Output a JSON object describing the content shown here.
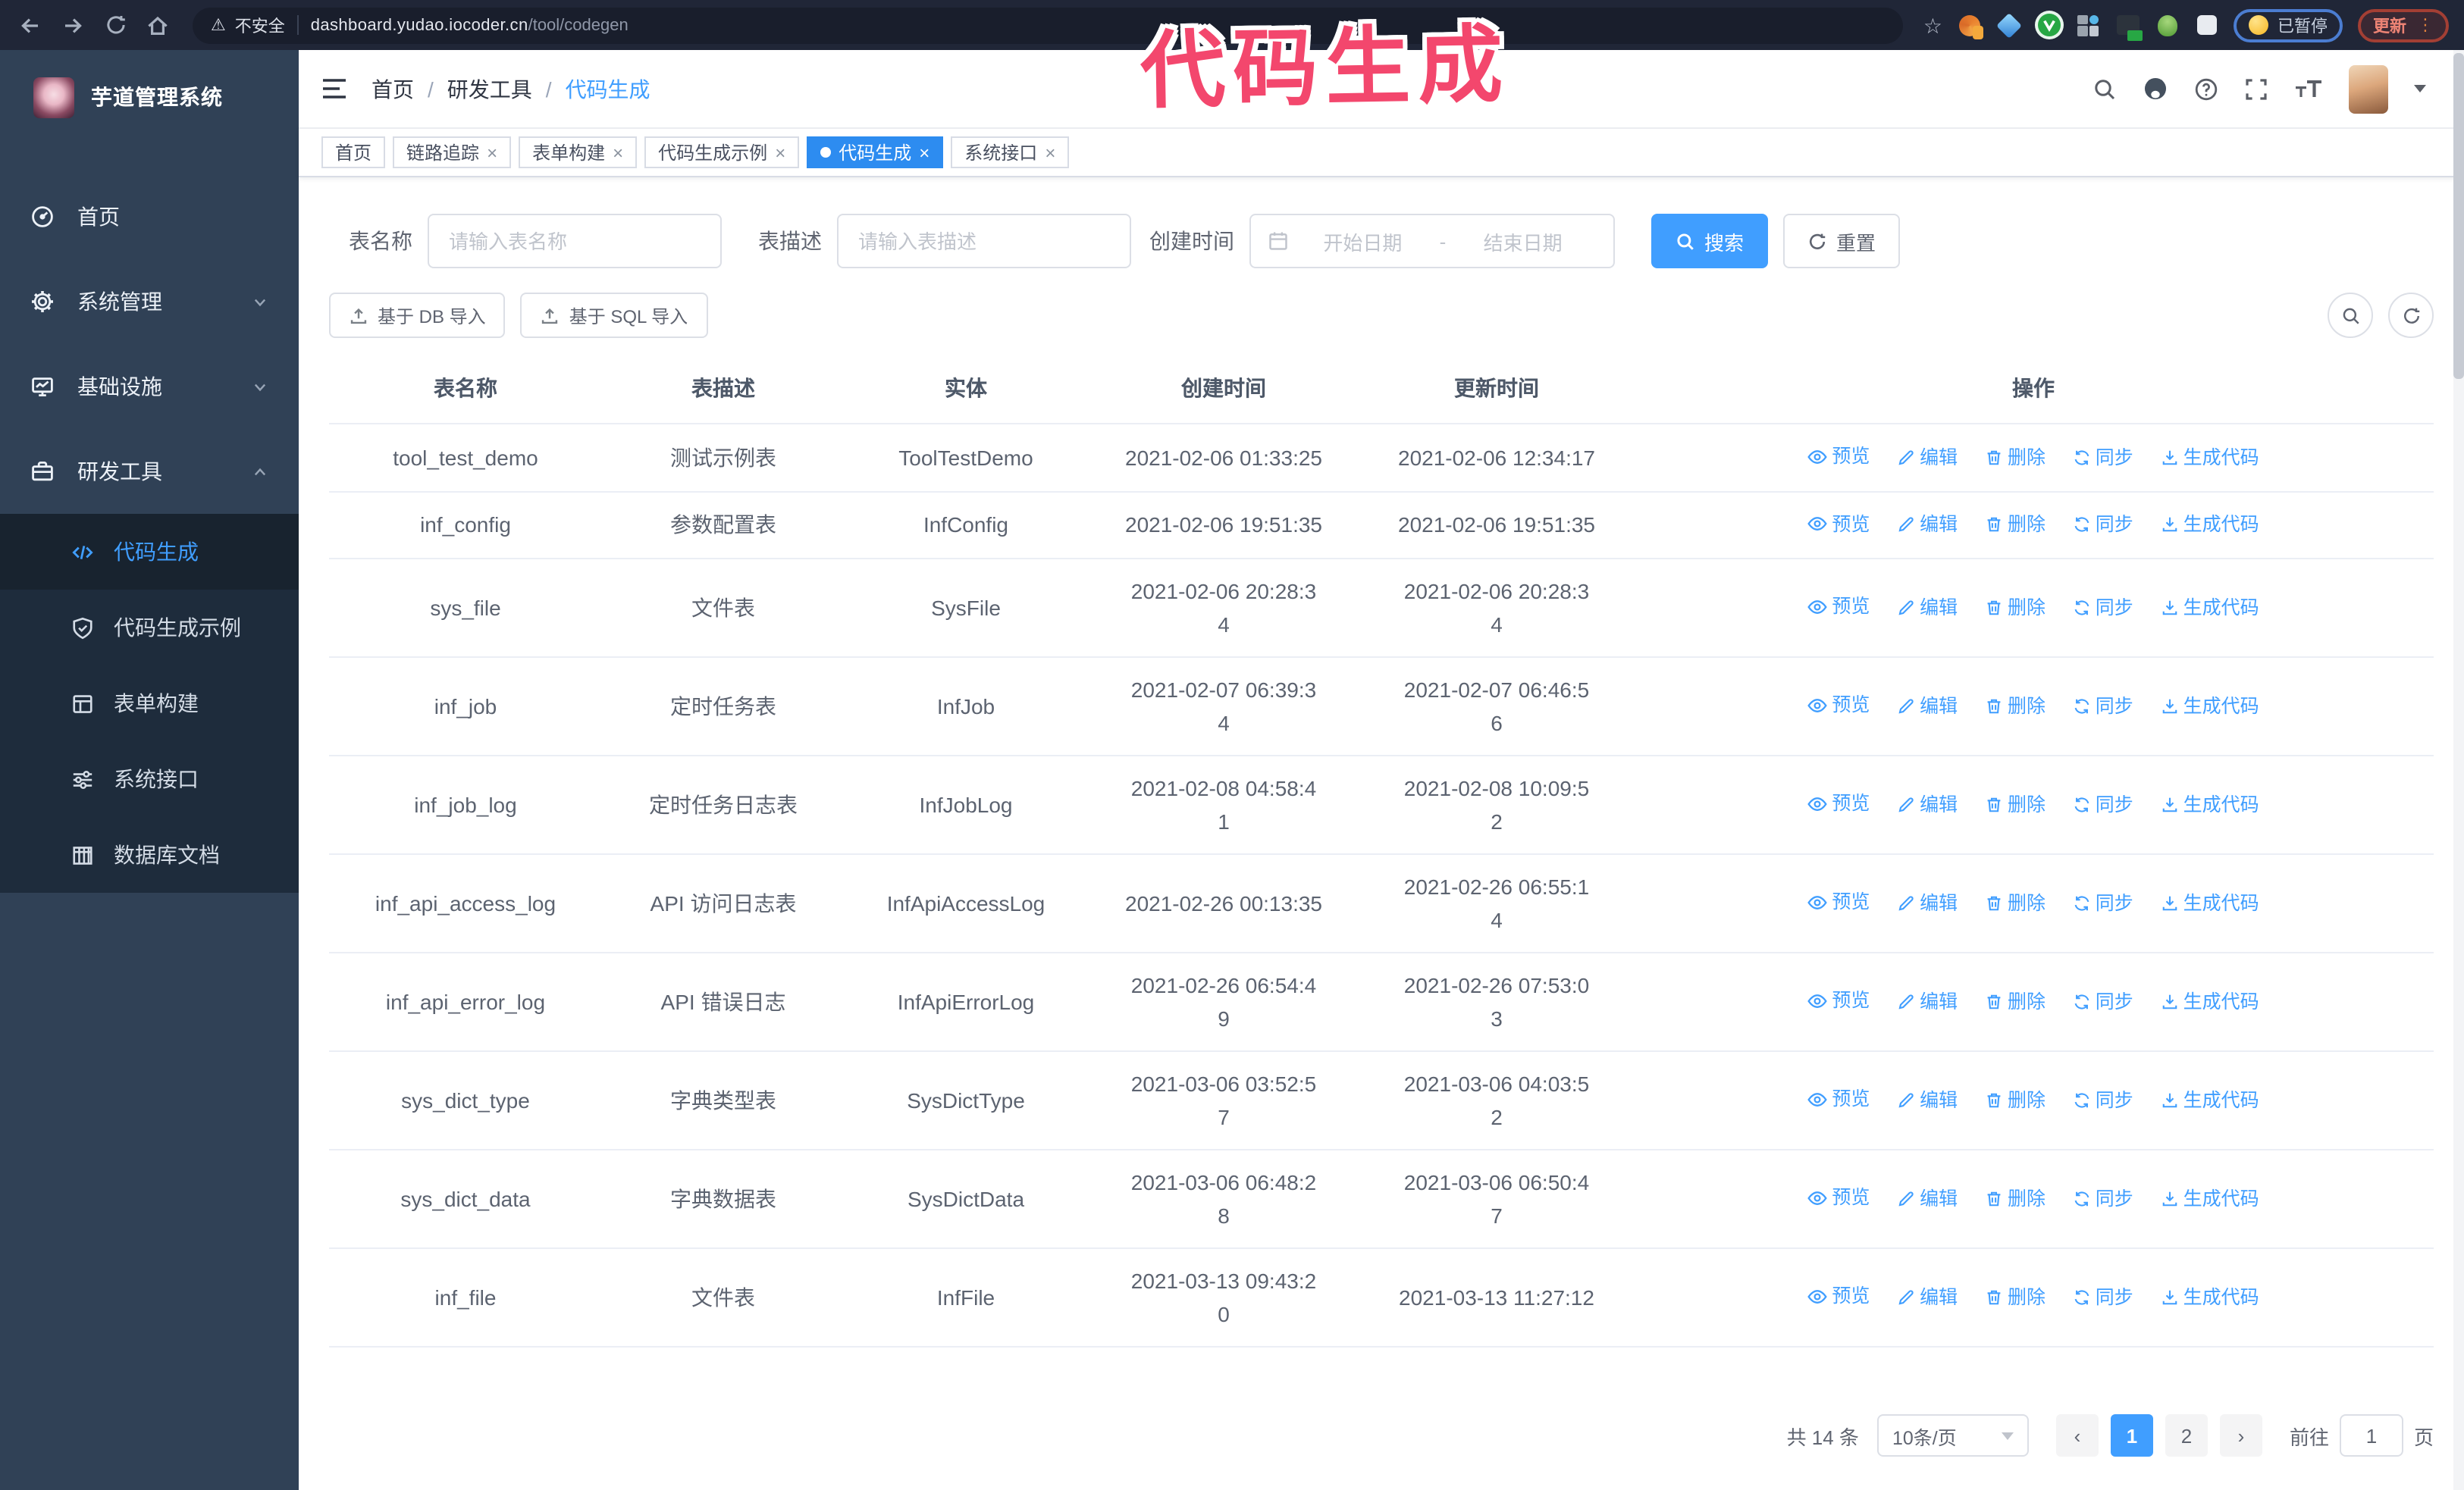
{
  "colors": {
    "primary": "#409eff",
    "sidebar_bg": "#304156",
    "submenu_bg": "#1e2c3c",
    "tab_active_bg": "#2d8cf0",
    "annotation": "#f3476d",
    "browser_bar_bg": "#202637"
  },
  "browser": {
    "security_label": "不安全",
    "url_host": "dashboard.yudao.iocoder.cn",
    "url_path": "/tool/codegen",
    "paused_badge": "已暂停",
    "update_badge": "更新",
    "update_menu_glyph": "⋮",
    "star_glyph": "☆",
    "warn_glyph": "⚠"
  },
  "annotation": {
    "text": "代码生成"
  },
  "sidebar": {
    "title": "芋道管理系统",
    "menu": [
      {
        "label": "首页"
      },
      {
        "label": "系统管理"
      },
      {
        "label": "基础设施"
      },
      {
        "label": "研发工具"
      }
    ],
    "submenu": [
      {
        "label": "代码生成",
        "active": true
      },
      {
        "label": "代码生成示例"
      },
      {
        "label": "表单构建"
      },
      {
        "label": "系统接口"
      },
      {
        "label": "数据库文档"
      }
    ]
  },
  "breadcrumb": {
    "separator": "/",
    "items": [
      "首页",
      "研发工具",
      "代码生成"
    ]
  },
  "tabs": [
    {
      "label": "首页",
      "closable": false,
      "active": false
    },
    {
      "label": "链路追踪",
      "closable": true,
      "active": false
    },
    {
      "label": "表单构建",
      "closable": true,
      "active": false
    },
    {
      "label": "代码生成示例",
      "closable": true,
      "active": false
    },
    {
      "label": "代码生成",
      "closable": true,
      "active": true
    },
    {
      "label": "系统接口",
      "closable": true,
      "active": false
    }
  ],
  "search": {
    "name_label": "表名称",
    "name_placeholder": "请输入表名称",
    "desc_label": "表描述",
    "desc_placeholder": "请输入表描述",
    "time_label": "创建时间",
    "start_placeholder": "开始日期",
    "end_placeholder": "结束日期",
    "range_separator": "-",
    "search_button": "搜索",
    "reset_button": "重置"
  },
  "toolbar": {
    "import_db_button": "基于 DB 导入",
    "import_sql_button": "基于 SQL 导入"
  },
  "table": {
    "headers": [
      "表名称",
      "表描述",
      "实体",
      "创建时间",
      "更新时间",
      "操作"
    ],
    "row_actions": [
      "预览",
      "编辑",
      "删除",
      "同步",
      "生成代码"
    ],
    "rows": [
      {
        "name": "tool_test_demo",
        "desc": "测试示例表",
        "entity": "ToolTestDemo",
        "created": "2021-02-06 01:33:25",
        "updated": "2021-02-06 12:34:17"
      },
      {
        "name": "inf_config",
        "desc": "参数配置表",
        "entity": "InfConfig",
        "created": "2021-02-06 19:51:35",
        "updated": "2021-02-06 19:51:35"
      },
      {
        "name": "sys_file",
        "desc": "文件表",
        "entity": "SysFile",
        "created": "2021-02-06 20:28:3\n4",
        "updated": "2021-02-06 20:28:3\n4"
      },
      {
        "name": "inf_job",
        "desc": "定时任务表",
        "entity": "InfJob",
        "created": "2021-02-07 06:39:3\n4",
        "updated": "2021-02-07 06:46:5\n6"
      },
      {
        "name": "inf_job_log",
        "desc": "定时任务日志表",
        "entity": "InfJobLog",
        "created": "2021-02-08 04:58:4\n1",
        "updated": "2021-02-08 10:09:5\n2"
      },
      {
        "name": "inf_api_access_log",
        "desc": "API 访问日志表",
        "entity": "InfApiAccessLog",
        "created": "2021-02-26 00:13:35",
        "updated": "2021-02-26 06:55:1\n4"
      },
      {
        "name": "inf_api_error_log",
        "desc": "API 错误日志",
        "entity": "InfApiErrorLog",
        "created": "2021-02-26 06:54:4\n9",
        "updated": "2021-02-26 07:53:0\n3"
      },
      {
        "name": "sys_dict_type",
        "desc": "字典类型表",
        "entity": "SysDictType",
        "created": "2021-03-06 03:52:5\n7",
        "updated": "2021-03-06 04:03:5\n2"
      },
      {
        "name": "sys_dict_data",
        "desc": "字典数据表",
        "entity": "SysDictData",
        "created": "2021-03-06 06:48:2\n8",
        "updated": "2021-03-06 06:50:4\n7"
      },
      {
        "name": "inf_file",
        "desc": "文件表",
        "entity": "InfFile",
        "created": "2021-03-13 09:43:2\n0",
        "updated": "2021-03-13 11:27:12"
      }
    ]
  },
  "pagination": {
    "total": "共 14 条",
    "page_size": "10条/页",
    "prev_glyph": "‹",
    "next_glyph": "›",
    "pages": [
      "1",
      "2"
    ],
    "active_page": "1",
    "goto_label": "前往",
    "goto_value": "1",
    "goto_unit": "页"
  }
}
